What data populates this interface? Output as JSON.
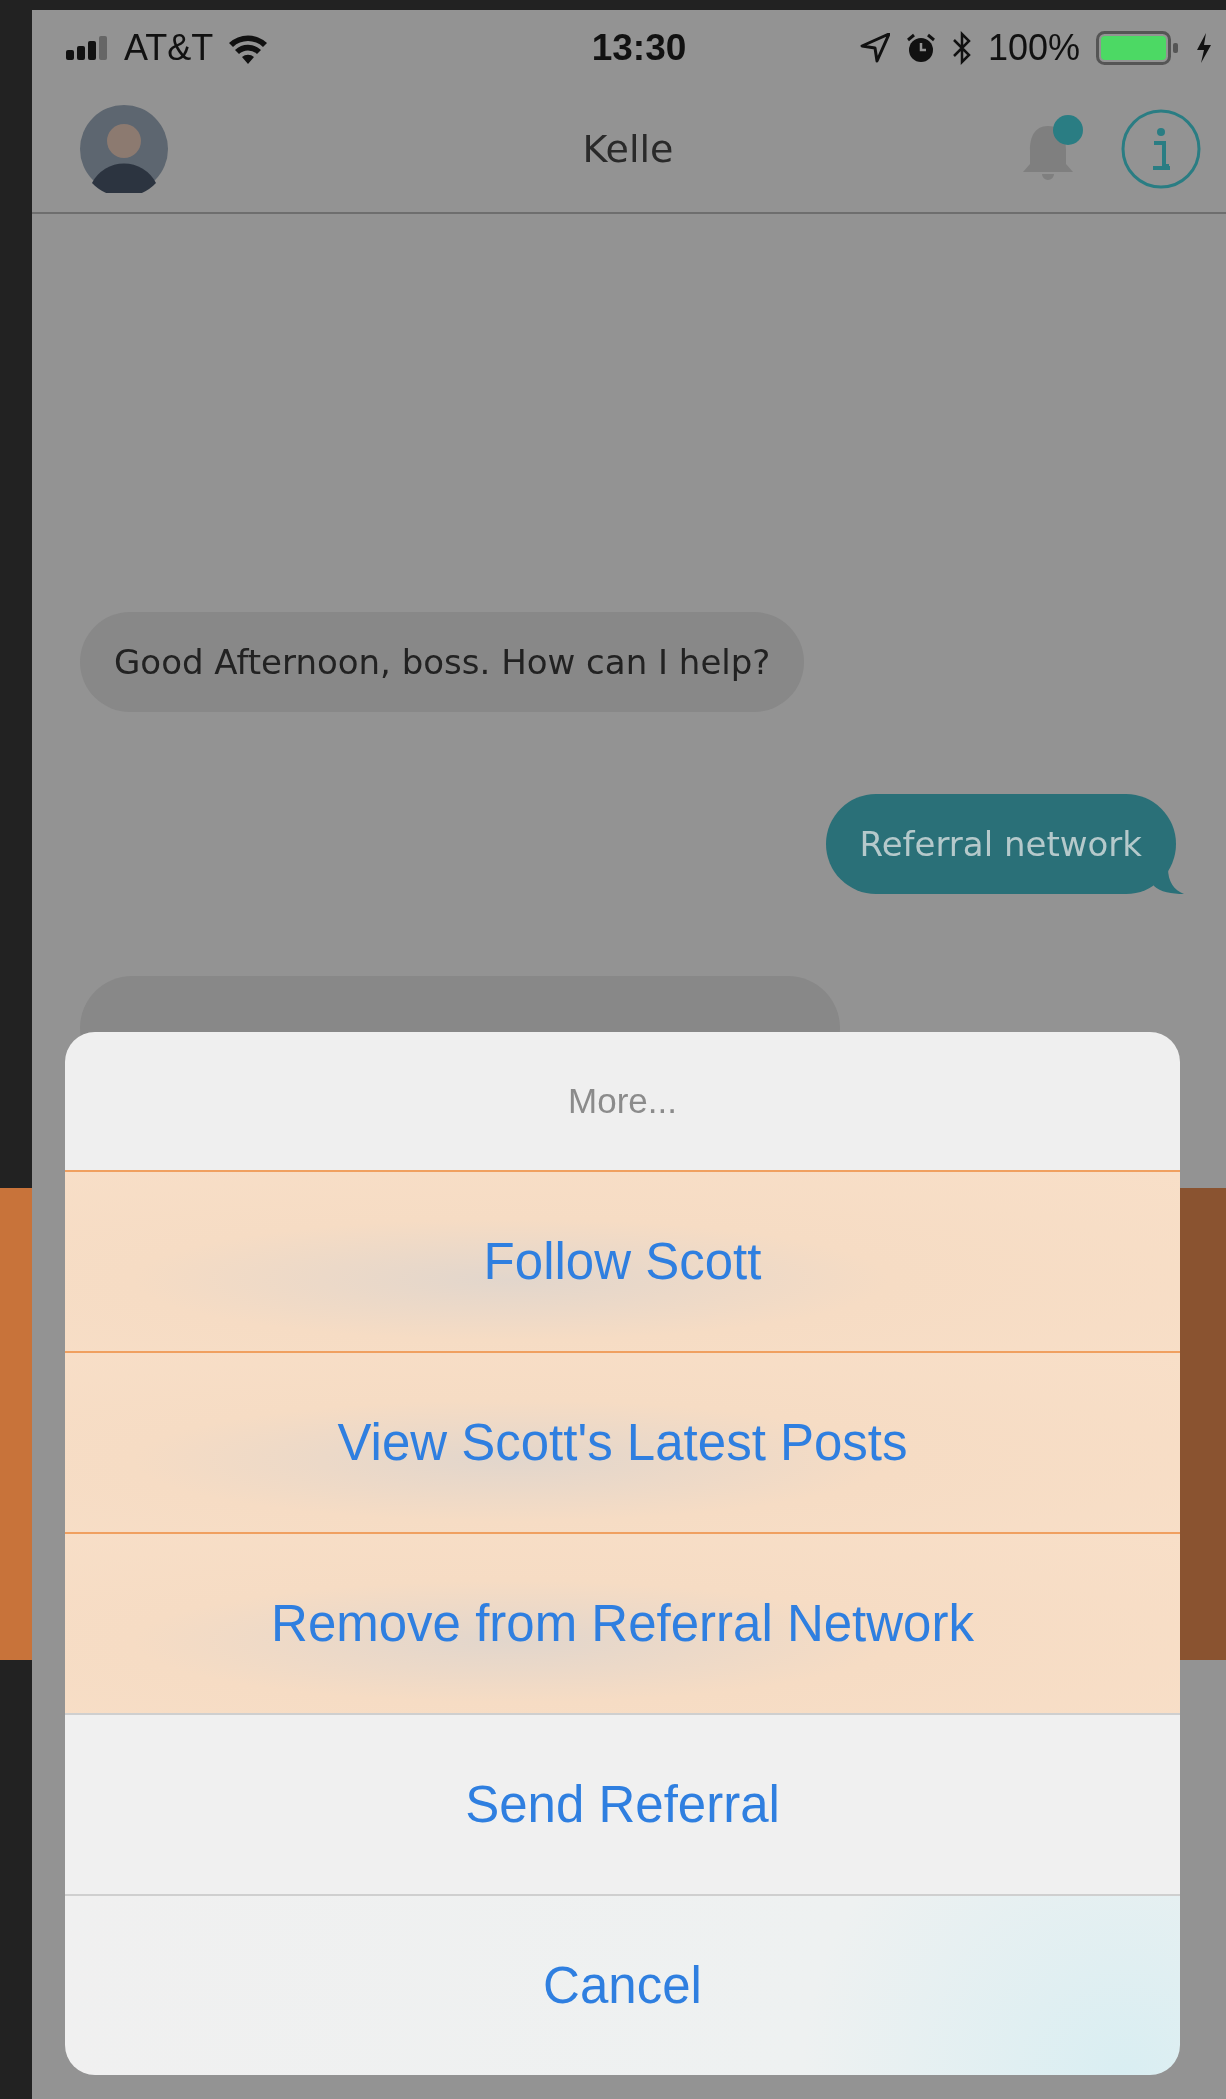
{
  "status_bar": {
    "carrier": "AT&T",
    "time": "13:30",
    "battery": "100%"
  },
  "header": {
    "title": "Kelle",
    "notification_badge": true
  },
  "messages": [
    {
      "kind": "incoming",
      "text": "Good Afternoon, boss. How can I help?"
    },
    {
      "kind": "outgoing",
      "text": "Referral network"
    }
  ],
  "action_sheet": {
    "title": "More...",
    "actions": [
      {
        "label": "Follow Scott",
        "highlighted": true
      },
      {
        "label": "View Scott's Latest Posts",
        "highlighted": true
      },
      {
        "label": "Remove from Referral Network",
        "highlighted": true
      },
      {
        "label": "Send Referral",
        "highlighted": false
      }
    ],
    "cancel": "Cancel"
  }
}
